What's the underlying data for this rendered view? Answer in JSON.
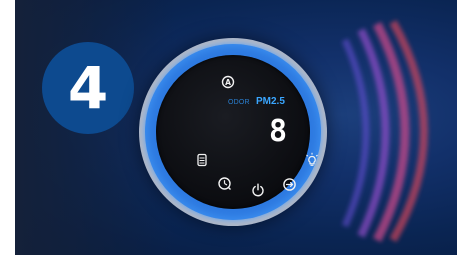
{
  "step": {
    "number": "4"
  },
  "display": {
    "odor_label": "ODOR",
    "pm_label": "PM2.5",
    "reading": "8"
  },
  "controls": [
    {
      "name": "auto-mode-icon",
      "glyph": "A"
    },
    {
      "name": "filter-icon"
    },
    {
      "name": "timer-icon"
    },
    {
      "name": "power-icon"
    },
    {
      "name": "fan-speed-icon"
    },
    {
      "name": "light-icon"
    }
  ],
  "colors": {
    "background": "#0a2553",
    "step_badge": "#0d4a8f",
    "ring": "#3a8ef0",
    "display_text": "#3aa6ff",
    "icon": "#f2f2f2"
  }
}
